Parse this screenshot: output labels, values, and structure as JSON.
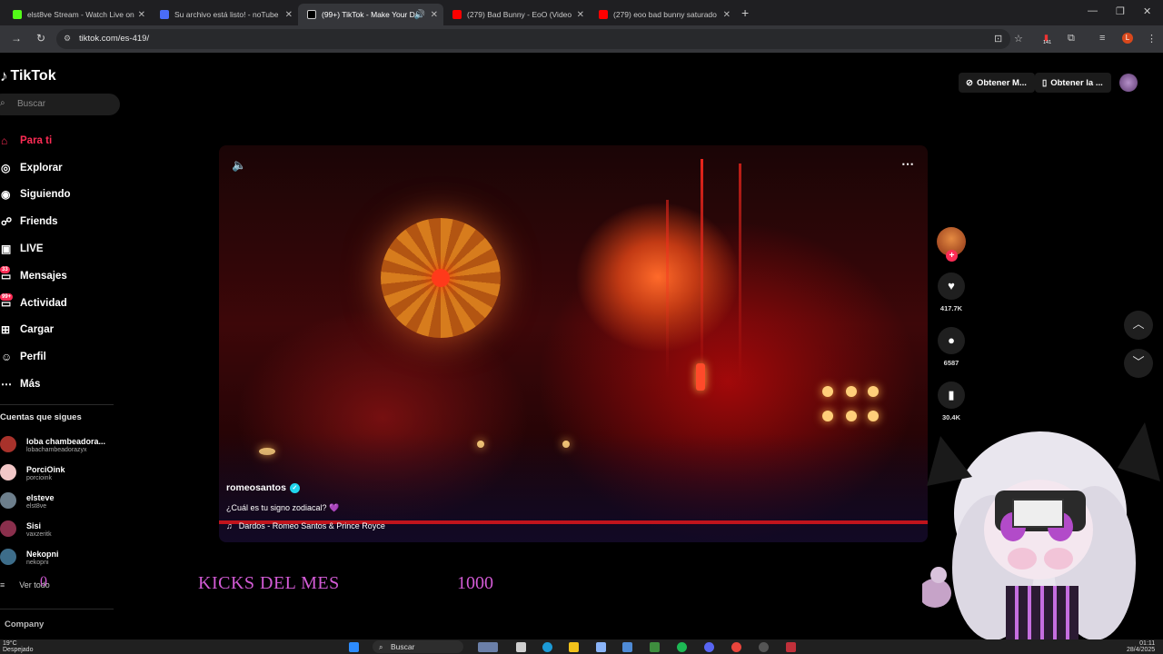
{
  "browser": {
    "tabs": [
      {
        "title": "elst8ve Stream - Watch Live on",
        "color": "#53fc18"
      },
      {
        "title": "Su archivo está listo! - noTube",
        "color": "#4a6cf7"
      },
      {
        "title": "(99+) TikTok - Make Your Da",
        "color": "#ffffff",
        "active": true
      },
      {
        "title": "(279) Bad Bunny - EoO (Video",
        "color": "#ff0000"
      },
      {
        "title": "(279) eoo bad bunny saturado",
        "color": "#ff0000"
      }
    ],
    "url": "tiktok.com/es-419/",
    "extension_badge": "141",
    "profile_initial": "L"
  },
  "tiktok": {
    "logo": "TikTok",
    "search_placeholder": "Buscar",
    "nav": [
      {
        "label": "Para ti",
        "icon": "home-icon",
        "glyph": "⌂"
      },
      {
        "label": "Explorar",
        "icon": "compass-icon",
        "glyph": "◎"
      },
      {
        "label": "Siguiendo",
        "icon": "following-icon",
        "glyph": "◉"
      },
      {
        "label": "Friends",
        "icon": "friends-icon",
        "glyph": "☍"
      },
      {
        "label": "LIVE",
        "icon": "live-icon",
        "glyph": "▣"
      },
      {
        "label": "Mensajes",
        "icon": "messages-icon",
        "glyph": "▭",
        "badge": "33"
      },
      {
        "label": "Actividad",
        "icon": "activity-icon",
        "glyph": "▭",
        "badge": "99+"
      },
      {
        "label": "Cargar",
        "icon": "upload-icon",
        "glyph": "⊞"
      },
      {
        "label": "Perfil",
        "icon": "profile-icon",
        "glyph": "☺"
      },
      {
        "label": "Más",
        "icon": "more-icon",
        "glyph": "⋯"
      }
    ],
    "following_title": "Cuentas que sigues",
    "following": [
      {
        "name": "loba chambeadora...",
        "handle": "lobachambeadorazyx",
        "color": "#a8322b"
      },
      {
        "name": "PorciOink",
        "handle": "porcioink",
        "color": "#f2c7c7"
      },
      {
        "name": "elsteve",
        "handle": "elst8ve",
        "color": "#6d7f8c"
      },
      {
        "name": "Sisi",
        "handle": "vaxzeritk",
        "color": "#8a2f4c"
      },
      {
        "name": "Nekopni",
        "handle": "nekopni",
        "color": "#3d6d8a"
      }
    ],
    "see_all": "Ver todo",
    "see_all_overlay": "0",
    "company": "Company",
    "header_buttons": [
      "Obtener M...",
      "Obtener la ..."
    ],
    "video": {
      "author": "romeosantos",
      "caption": "¿Cuál es tu signo zodiacal? 💜",
      "sound": "Dardos - Romeo Santos & Prince Royce"
    },
    "counts": {
      "likes": "417.7K",
      "comments": "6587",
      "saves": "30.4K"
    }
  },
  "overlay": {
    "kicks_label": "KICKS DEL MES",
    "kicks_value": "1000",
    "accent": "#d35bd6"
  },
  "taskbar": {
    "temperature": "19°C",
    "weather": "Despejado",
    "search": "Buscar",
    "time": "01:11",
    "date": "28/4/2025"
  }
}
